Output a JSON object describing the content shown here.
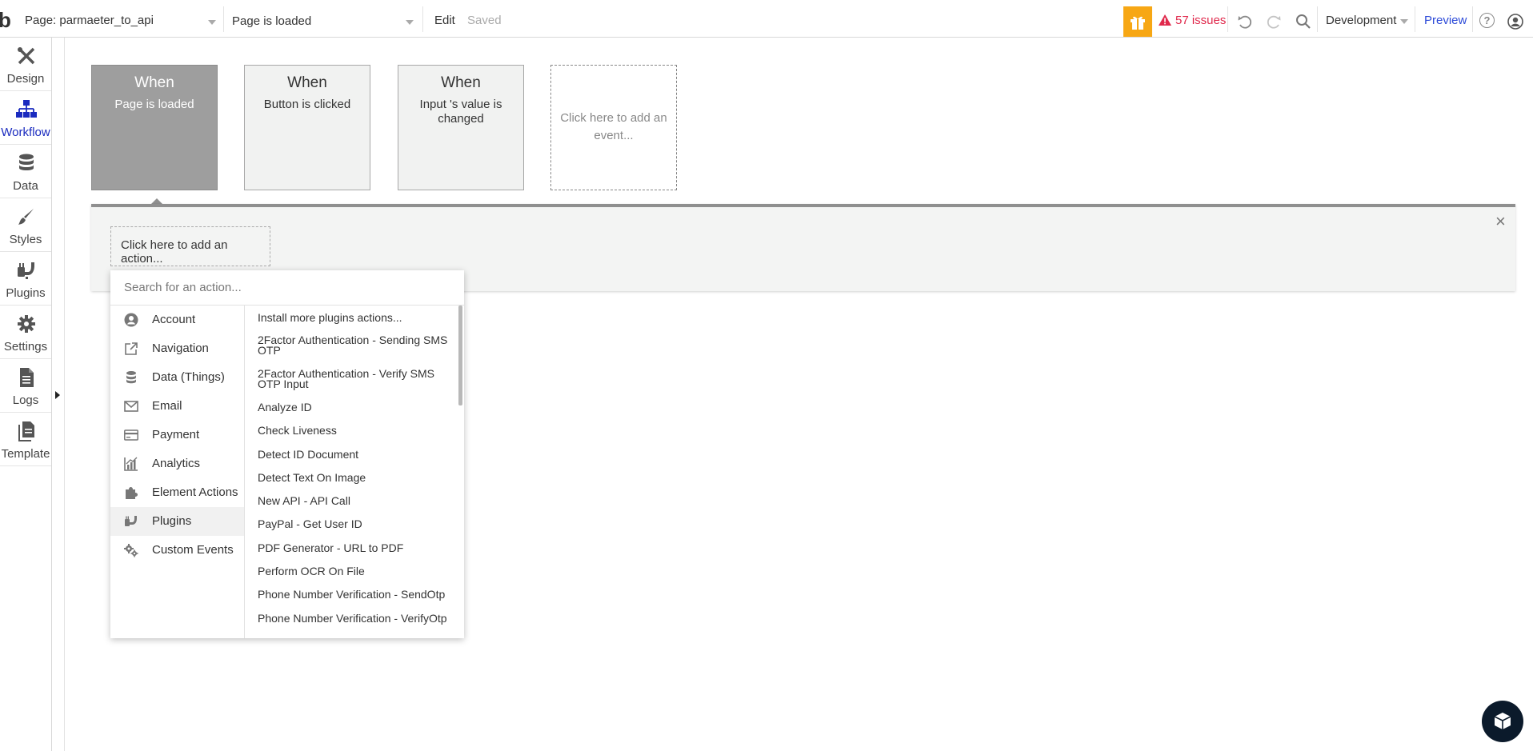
{
  "topbar": {
    "logo": "b",
    "page_selector": "Page: parmaeter_to_api",
    "event_selector": "Page is loaded",
    "edit_label": "Edit",
    "saved_label": "Saved",
    "issues_label": "57 issues",
    "environment": "Development",
    "preview_label": "Preview",
    "colors": {
      "gift": "#f7a714",
      "issues": "#e0294c",
      "preview": "#2c4ad8"
    }
  },
  "sidebar": {
    "items": [
      {
        "label": "Design",
        "icon": "design-tools-icon"
      },
      {
        "label": "Workflow",
        "icon": "workflow-icon",
        "active": true
      },
      {
        "label": "Data",
        "icon": "database-icon"
      },
      {
        "label": "Styles",
        "icon": "brush-icon"
      },
      {
        "label": "Plugins",
        "icon": "plugins-icon"
      },
      {
        "label": "Settings",
        "icon": "gear-icon"
      },
      {
        "label": "Logs",
        "icon": "document-icon"
      },
      {
        "label": "Template",
        "icon": "template-icon"
      }
    ],
    "active_color": "#1a2bbf"
  },
  "events": [
    {
      "when": "When",
      "desc": "Page is loaded",
      "selected": true
    },
    {
      "when": "When",
      "desc": "Button is clicked"
    },
    {
      "when": "When",
      "desc": "Input 's value is changed"
    },
    {
      "desc": "Click here to add an event..."
    }
  ],
  "action_strip": {
    "add_action": "Click here to add an action...",
    "close": "×"
  },
  "action_picker": {
    "search_placeholder": "Search for an action...",
    "categories": [
      {
        "label": "Account",
        "icon": "user-circle-icon"
      },
      {
        "label": "Navigation",
        "icon": "external-link-icon"
      },
      {
        "label": "Data (Things)",
        "icon": "database-icon"
      },
      {
        "label": "Email",
        "icon": "envelope-icon"
      },
      {
        "label": "Payment",
        "icon": "credit-card-icon"
      },
      {
        "label": "Analytics",
        "icon": "analytics-icon"
      },
      {
        "label": "Element Actions",
        "icon": "puzzle-icon"
      },
      {
        "label": "Plugins",
        "icon": "plugins-icon",
        "active": true
      },
      {
        "label": "Custom Events",
        "icon": "gears-icon"
      }
    ],
    "actions": [
      "Install more plugins actions...",
      "2Factor Authentication - Sending SMS OTP",
      "2Factor Authentication - Verify SMS OTP Input",
      "Analyze ID",
      "Check Liveness",
      "Detect ID Document",
      "Detect Text On Image",
      "New API - API Call",
      "PayPal - Get User ID",
      "PDF Generator - URL to PDF",
      "Perform OCR On File",
      "Phone Number Verification - SendOtp",
      "Phone Number Verification - VerifyOtp"
    ]
  }
}
